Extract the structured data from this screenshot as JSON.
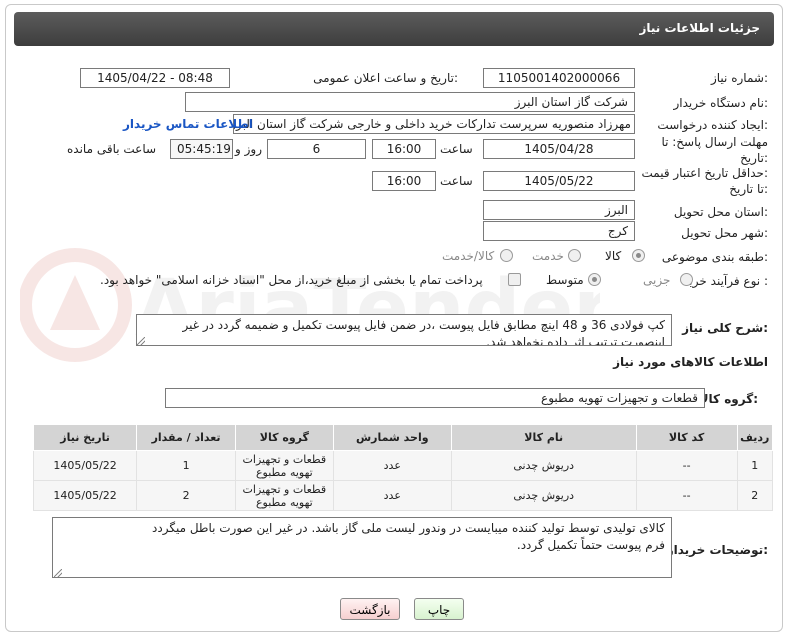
{
  "header": {
    "title": "جزئیات اطلاعات نیاز"
  },
  "form": {
    "need_number": {
      "label": "شماره نیاز:",
      "value": "1105001402000066"
    },
    "announce_datetime": {
      "label": "تاریخ و ساعت اعلان عمومی:",
      "value": "1405/04/22 - 08:48"
    },
    "buyer_org": {
      "label": "نام دستگاه خریدار:",
      "value": "شرکت گاز استان البرز"
    },
    "requester": {
      "label": "ایجاد کننده درخواست:",
      "value": "مهرزاد منصوریه سرپرست تدارکات خرید داخلی و خارجی شرکت گاز استان البرز",
      "contact_link": "اطلاعات تماس خریدار"
    },
    "deadline": {
      "label_line1": "مهلت ارسال پاسخ: تا",
      "label_line2": "تاریخ:",
      "date": "1405/04/28",
      "time_label": "ساعت",
      "time": "16:00",
      "days": "6",
      "days_label": "روز و",
      "remaining": "05:45:19",
      "remaining_label": "ساعت باقی مانده"
    },
    "price_validity": {
      "label_line1": "حداقل تاریخ اعتبار قیمت:",
      "label_line2": "تا تاریخ:",
      "date": "1405/05/22",
      "time_label": "ساعت",
      "time": "16:00"
    },
    "province": {
      "label": "استان محل تحویل:",
      "value": "البرز"
    },
    "city": {
      "label": "شهر محل تحویل:",
      "value": "کرج"
    },
    "category": {
      "label": "طبقه بندی موضوعی:",
      "options": [
        "کالا",
        "خدمت",
        "کالا/خدمت"
      ],
      "selected": "کالا"
    },
    "process_type": {
      "label": "نوع فرآیند خرید :",
      "options": [
        "جزیی",
        "متوسط"
      ],
      "selected": "متوسط",
      "payment_note": "پرداخت تمام یا بخشی از مبلغ خرید،از محل \"اسناد خزانه اسلامی\" خواهد بود."
    }
  },
  "description": {
    "label": "شرح کلی نیاز:",
    "text": "کپ فولادی 36 و 48 اینچ مطابق فایل پیوست ،در ضمن فایل پیوست تکمیل و ضمیمه گردد در غیر اینصورت ترتیب اثر داده نخواهد شد."
  },
  "goods_section": {
    "title": "اطلاعات کالاهای مورد نیاز"
  },
  "goods_group": {
    "label": "گروه کالا:",
    "value": "قطعات و تجهیزات تهویه مطبوع"
  },
  "table": {
    "headers": [
      "ردیف",
      "کد کالا",
      "نام کالا",
      "واحد شمارش",
      "گروه کالا",
      "تعداد / مقدار",
      "تاریخ نیاز"
    ],
    "rows": [
      [
        "1",
        "--",
        "دریوش چدنی",
        "عدد",
        "قطعات و تجهیزات تهویه مطبوع",
        "1",
        "1405/05/22"
      ],
      [
        "2",
        "--",
        "دریوش چدنی",
        "عدد",
        "قطعات و تجهیزات تهویه مطبوع",
        "2",
        "1405/05/22"
      ]
    ]
  },
  "buyer_notes": {
    "label": "توضیحات خریدار:",
    "line1": "کالای تولیدی توسط تولید کننده میبایست در وندور لیست ملی گاز باشد. در غیر این صورت باطل میگردد",
    "line2": "فرم پیوست حتماً تکمیل گردد."
  },
  "buttons": {
    "print": "چاپ",
    "back": "بازگشت"
  },
  "watermark_text": "AriaTender.net"
}
